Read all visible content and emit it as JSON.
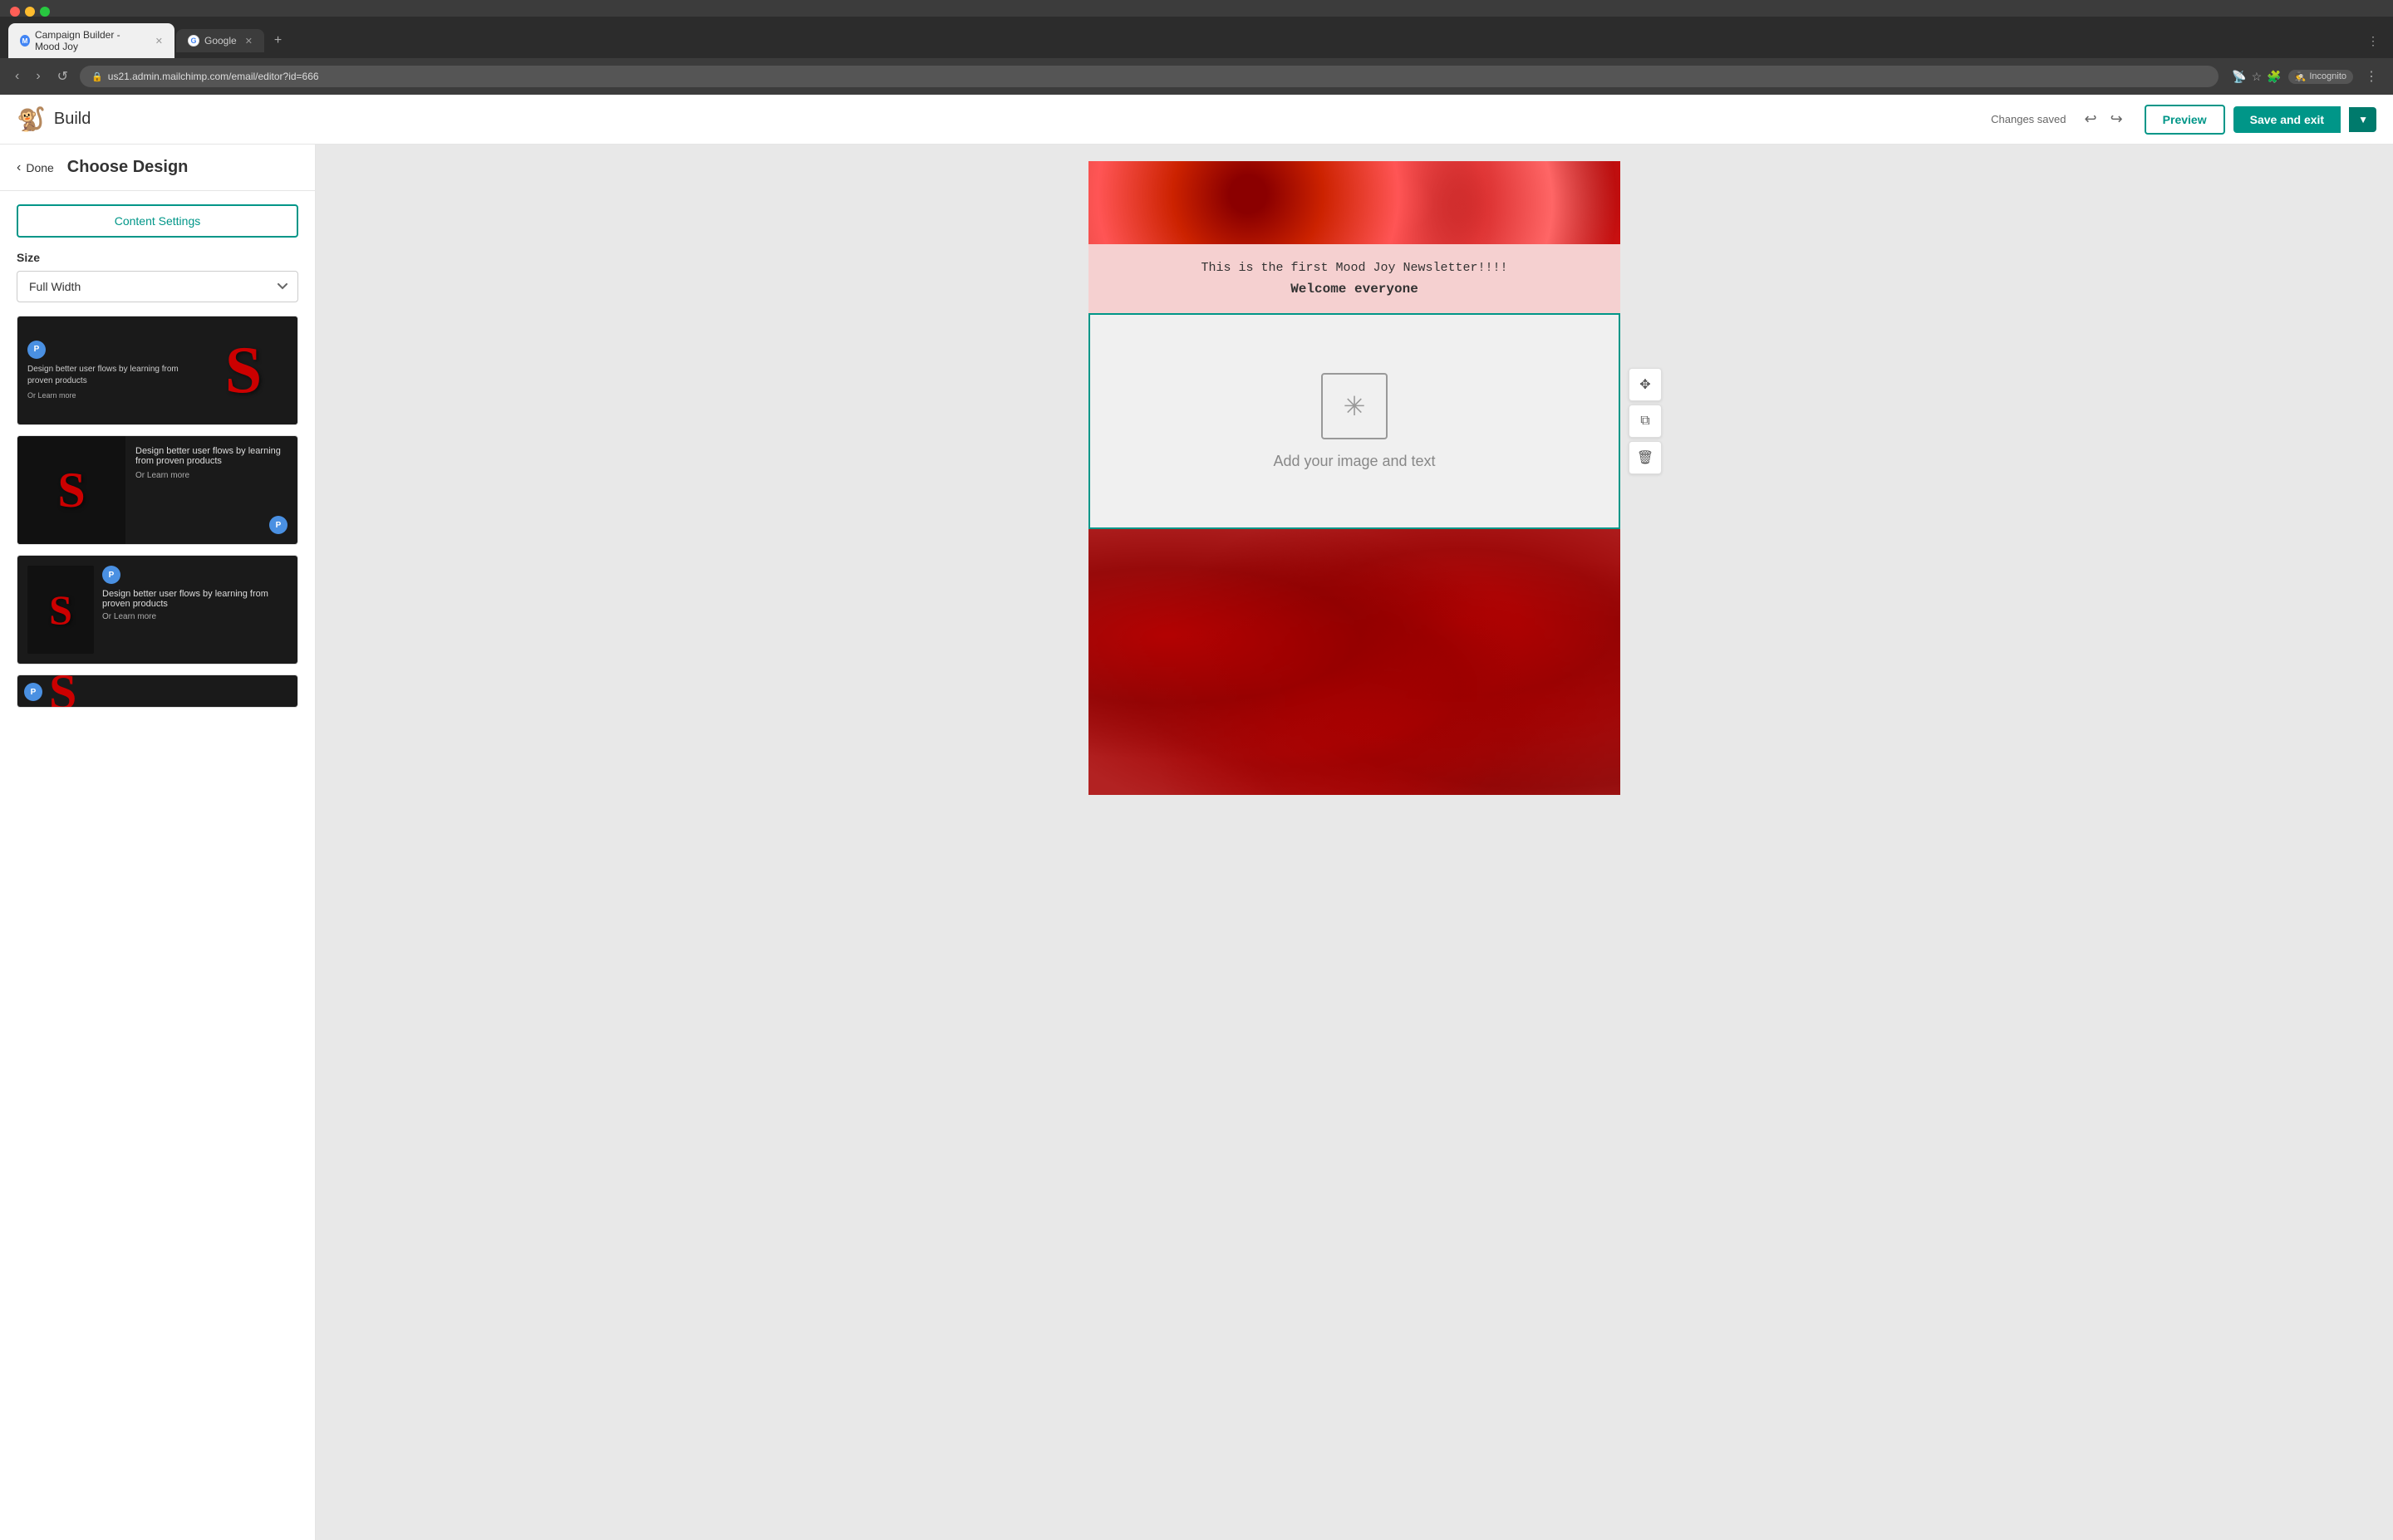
{
  "browser": {
    "url": "us21.admin.mailchimp.com/email/editor?id=666",
    "tab1_label": "Campaign Builder - Mood Joy",
    "tab2_label": "Google",
    "incognito_label": "Incognito"
  },
  "app": {
    "logo_alt": "Mailchimp",
    "title": "Build",
    "status": "Changes saved",
    "preview_label": "Preview",
    "save_label": "Save and exit"
  },
  "panel": {
    "back_label": "Done",
    "title": "Choose Design",
    "content_settings_label": "Content Settings",
    "size_label": "Size",
    "size_option": "Full Width"
  },
  "design_cards": [
    {
      "badge": "P",
      "description": "Design better user flows by learning from proven products",
      "learn_more": "Or Learn more"
    },
    {
      "badge": "P",
      "description": "Design better user flows by learning from proven products",
      "learn_more": "Or Learn more"
    },
    {
      "badge": "P",
      "description": "Design better user flows by learning from proven products",
      "learn_more": "Or Learn more"
    }
  ],
  "email": {
    "campaign_name": "Mood Joy",
    "intro_text": "This is the first",
    "intro_link": "Mood Joy",
    "intro_end": "Newsletter!!!!",
    "welcome_text": "Welcome everyone",
    "content_placeholder": "Add your image and text"
  },
  "toolbar": {
    "move_icon": "✥",
    "duplicate_icon": "⧉",
    "delete_icon": "🗑"
  }
}
